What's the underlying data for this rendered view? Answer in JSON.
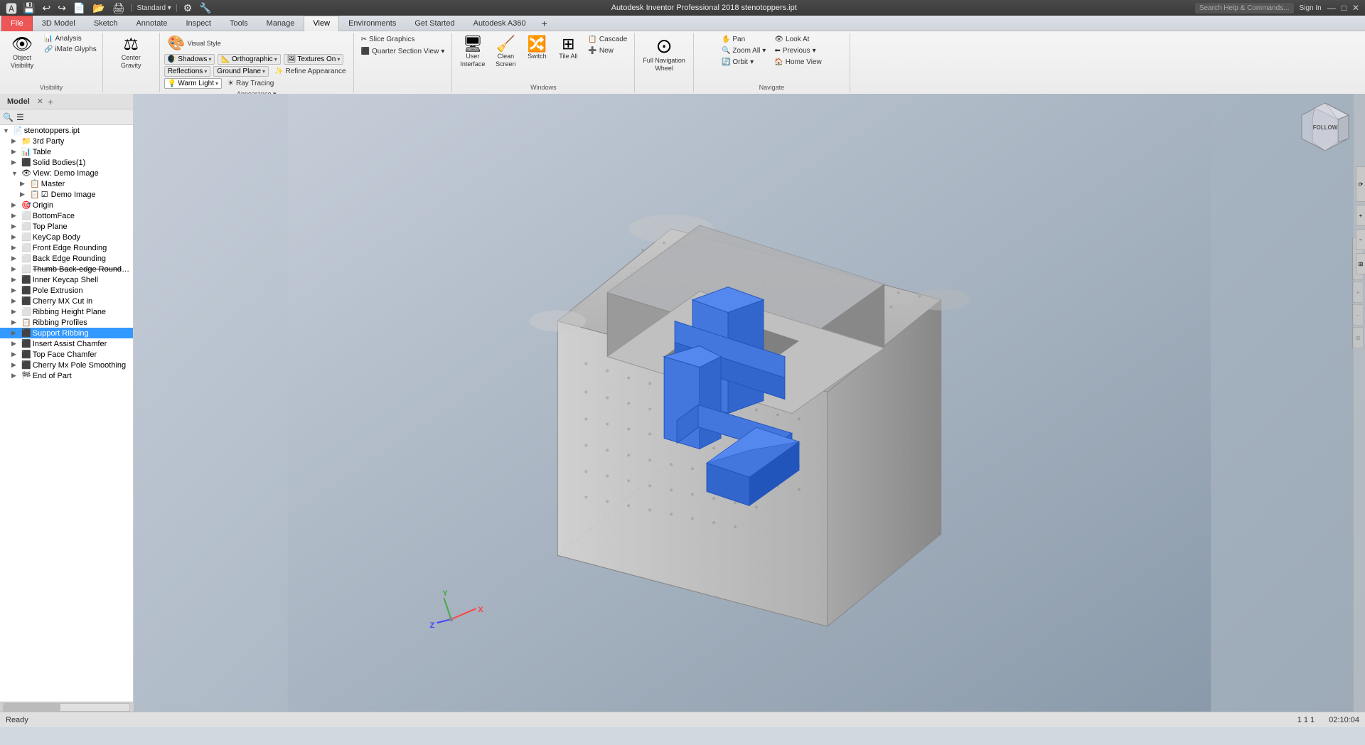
{
  "titlebar": {
    "title": "Autodesk Inventor Professional 2018  stenotoppers.ipt",
    "search_placeholder": "Search Help & Commands...",
    "sign_in": "Sign In",
    "min": "—",
    "max": "□",
    "close": "✕"
  },
  "ribbon": {
    "tabs": [
      "File",
      "3D Model",
      "Sketch",
      "Annotate",
      "Inspect",
      "Tools",
      "Manage",
      "View",
      "Environments",
      "Get Started",
      "Autodesk A360"
    ],
    "active_tab": "View",
    "groups": {
      "visibility": {
        "label": "Visibility",
        "items": [
          "Object Visibility",
          "Analysis",
          "iMate Glyphs"
        ]
      },
      "appearance": {
        "label": "Appearance",
        "visual_style_label": "Visual Style",
        "shadows_label": "Shadows",
        "reflections_label": "Reflections",
        "warm_light_label": "Warm Light",
        "orthographic_label": "Orthographic",
        "textures_label": "Textures On",
        "ground_plane_label": "Ground Plane",
        "refine_label": "Refine Appearance",
        "ray_tracing_label": "Ray Tracing"
      },
      "slice": {
        "label": "",
        "slice_graphics": "Slice Graphics",
        "quarter_section": "Quarter Section View"
      },
      "windows": {
        "label": "Windows",
        "user_interface": "User\nInterface",
        "clean_screen": "Clean\nScreen",
        "switch": "Switch",
        "tile_all": "Tile All",
        "cascade": "Cascade",
        "new": "New"
      },
      "fullnav": {
        "label": "Full Navigation\nWheel",
        "wheel_label": "Full Navigation\nWheel"
      },
      "navigate": {
        "label": "Navigate",
        "pan": "Pan",
        "look_at": "Look At",
        "zoom_all": "Zoom All",
        "previous": "Previous",
        "orbit": "Orbit",
        "home_view": "Home View"
      },
      "center_gravity": {
        "label": "Center Gravity"
      }
    }
  },
  "model_panel": {
    "tab_label": "Model",
    "close_icon": "✕",
    "add_icon": "+",
    "search_icon": "🔍",
    "menu_icon": "☰",
    "filename": "stenotoppers.ipt",
    "tree_items": [
      {
        "label": "stenotoppers.ipt",
        "level": 0,
        "expand": true,
        "icon": "📄"
      },
      {
        "label": "3rd Party",
        "level": 1,
        "expand": false,
        "icon": "📁"
      },
      {
        "label": "Table",
        "level": 1,
        "expand": false,
        "icon": "📊"
      },
      {
        "label": "Solid Bodies(1)",
        "level": 1,
        "expand": false,
        "icon": "⬛"
      },
      {
        "label": "View: Demo Image",
        "level": 1,
        "expand": true,
        "icon": "👁"
      },
      {
        "label": "Master",
        "level": 2,
        "expand": false,
        "icon": "📋"
      },
      {
        "label": "Demo Image",
        "level": 2,
        "expand": false,
        "icon": "📋",
        "checked": true
      },
      {
        "label": "Origin",
        "level": 1,
        "expand": false,
        "icon": "🎯"
      },
      {
        "label": "BottomFace",
        "level": 1,
        "expand": false,
        "icon": "⬜"
      },
      {
        "label": "Top Plane",
        "level": 1,
        "expand": false,
        "icon": "⬜"
      },
      {
        "label": "KeyCap Body",
        "level": 1,
        "expand": false,
        "icon": "⬜"
      },
      {
        "label": "Front Edge Rounding",
        "level": 1,
        "expand": false,
        "icon": "⬜"
      },
      {
        "label": "Back Edge Rounding",
        "level": 1,
        "expand": false,
        "icon": "⬜"
      },
      {
        "label": "Thumb Back-edge Rounding (Suppressed)",
        "level": 1,
        "expand": false,
        "icon": "⬜",
        "strikethrough": true
      },
      {
        "label": "Inner Keycap Shell",
        "level": 1,
        "expand": false,
        "icon": "⬛"
      },
      {
        "label": "Pole Extrusion",
        "level": 1,
        "expand": false,
        "icon": "⬛"
      },
      {
        "label": "Cherry MX Cut in",
        "level": 1,
        "expand": false,
        "icon": "⬛"
      },
      {
        "label": "Ribbing Height Plane",
        "level": 1,
        "expand": false,
        "icon": "⬜"
      },
      {
        "label": "Ribbing Profiles",
        "level": 1,
        "expand": false,
        "icon": "📋"
      },
      {
        "label": "Support Ribbing",
        "level": 1,
        "expand": false,
        "icon": "⬛",
        "selected": true
      },
      {
        "label": "Insert Assist Chamfer",
        "level": 1,
        "expand": false,
        "icon": "⬛"
      },
      {
        "label": "Top Face Chamfer",
        "level": 1,
        "expand": false,
        "icon": "⬛"
      },
      {
        "label": "Cherry Mx Pole Smoothing",
        "level": 1,
        "expand": false,
        "icon": "⬛"
      },
      {
        "label": "End of Part",
        "level": 1,
        "expand": false,
        "icon": "🏁"
      }
    ]
  },
  "viewport": {
    "background_gradient": [
      "#c5cdd8",
      "#9daab8"
    ]
  },
  "status_bar": {
    "status": "Ready",
    "page_numbers": "1    1    1"
  },
  "nav_cube": {
    "label": "FOLLOW"
  },
  "axis": {
    "x": "X",
    "y": "Y",
    "z": "Z"
  }
}
